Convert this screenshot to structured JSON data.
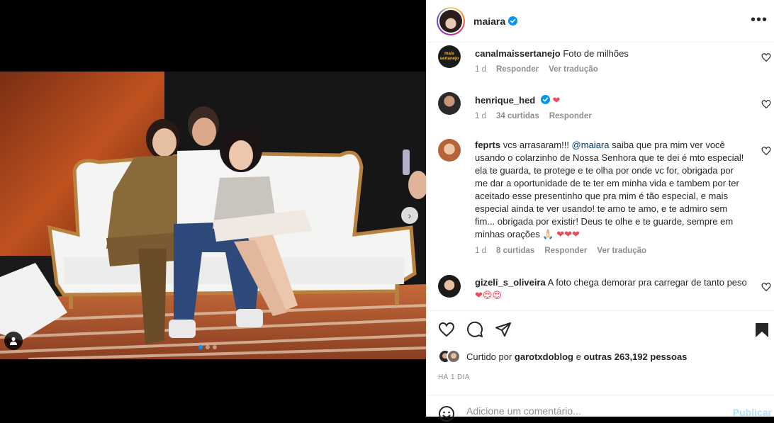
{
  "post": {
    "author": "maiara",
    "more_icon": "more-icon"
  },
  "comments": [
    {
      "user": "canalmaissertanejo",
      "text": "Foto de milhões",
      "time": "1 d",
      "reply": "Responder",
      "translate": "Ver tradução",
      "avatar_text": "mais sertanejo"
    },
    {
      "user": "henrique_hed",
      "text": "",
      "emoji": "❤",
      "time": "1 d",
      "likes": "34 curtidas",
      "reply": "Responder"
    },
    {
      "user": "feprts",
      "text_before": "vcs arrasaram!!! ",
      "mention": "@maiara",
      "text_after": " saiba que pra mim ver você usando o colarzinho de Nossa Senhora que te dei é mto especial! ela te guarda, te protege e te olha por onde vc for, obrigada por me dar a oportunidade de te ter em minha vida e tambem por ter aceitado esse presentinho que pra mim é tão especial, e mais especial ainda te ver usando! te amo te amo, e te admiro sem fim... obrigada por existir! Deus te olhe e te guarde, sempre em minhas orações 🙏🏻",
      "emoji": "❤❤❤",
      "time": "1 d",
      "likes": "8 curtidas",
      "reply": "Responder",
      "translate": "Ver tradução"
    },
    {
      "user": "gizeli_s_oliveira",
      "text": "A foto chega demorar pra carregar de tanto peso",
      "emoji": "❤😍😍"
    }
  ],
  "liked": {
    "prefix": "Curtido por ",
    "user": "garotxdoblog",
    "middle": " e ",
    "others": "outras 263,192 pessoas"
  },
  "time_ago": "HÁ 1 DIA",
  "comment_input": {
    "placeholder": "Adicione um comentário...",
    "publish": "Publicar"
  },
  "colors": {
    "accent": "#0095f6",
    "heart": "#ed4956",
    "muted": "#8e8e8e"
  }
}
